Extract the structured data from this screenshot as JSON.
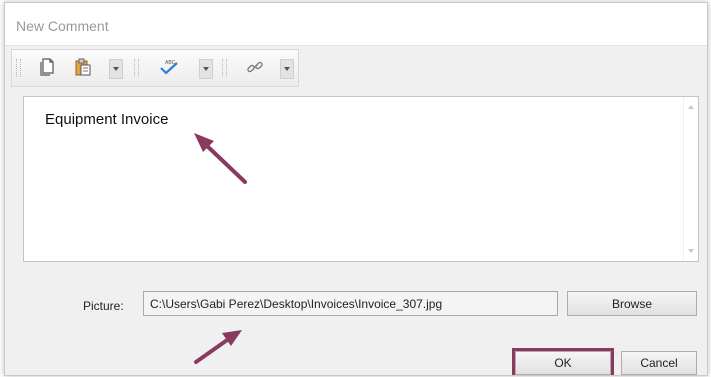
{
  "window": {
    "title": "New Comment"
  },
  "toolbar": {
    "buttons": [
      {
        "icon": "copy-icon"
      },
      {
        "icon": "paste-icon"
      },
      {
        "icon": "spellcheck-icon"
      },
      {
        "icon": "link-icon"
      }
    ]
  },
  "editor": {
    "text": "Equipment Invoice"
  },
  "picture": {
    "label": "Picture:",
    "path": "C:\\Users\\Gabi Perez\\Desktop\\Invoices\\Invoice_307.jpg"
  },
  "buttons": {
    "browse": "Browse",
    "ok": "OK",
    "cancel": "Cancel"
  },
  "colors": {
    "annotation_arrow": "#8b3a5f",
    "ok_highlight": "#8b3a5f"
  }
}
